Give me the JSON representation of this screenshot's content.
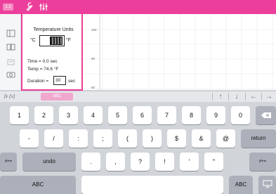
{
  "toolbar": {
    "tab_label": "1.1",
    "accent_color": "#ec3f9b",
    "icons": [
      "wrench-icon",
      "sliders-icon"
    ]
  },
  "rail": {
    "icons": [
      "pages-icon",
      "book-icon",
      "pencil-icon",
      "camera-icon"
    ]
  },
  "panel": {
    "title": "Temperature Units",
    "unit_left": "°C",
    "unit_right": "°F",
    "selected_unit": "°F",
    "time_readout": "Time = 0.0 sec",
    "temp_readout": "Temp = 74.6 °F",
    "duration_label": "Duration =",
    "duration_value": "30",
    "duration_unit": "sec"
  },
  "graph": {
    "y_ticks": [
      "100",
      "80",
      "60"
    ]
  },
  "entry": {
    "fx_label": "fx [x]",
    "abc_label": "ABC",
    "arrows": [
      "↑",
      "↓",
      "←",
      "→"
    ]
  },
  "keyboard": {
    "row1": [
      "1",
      "2",
      "3",
      "4",
      "5",
      "6",
      "7",
      "8",
      "9",
      "0"
    ],
    "row2": [
      "-",
      "/",
      ":",
      ";",
      "(",
      ")",
      "$",
      "&",
      "@"
    ],
    "return_label": "return",
    "row3_left": "#+=",
    "undo_label": "undo",
    "row3": [
      ".",
      ",",
      "?",
      "!",
      "'",
      "\""
    ],
    "row3_right": "#+=",
    "abc_left": "ABC",
    "abc_right": "ABC"
  }
}
